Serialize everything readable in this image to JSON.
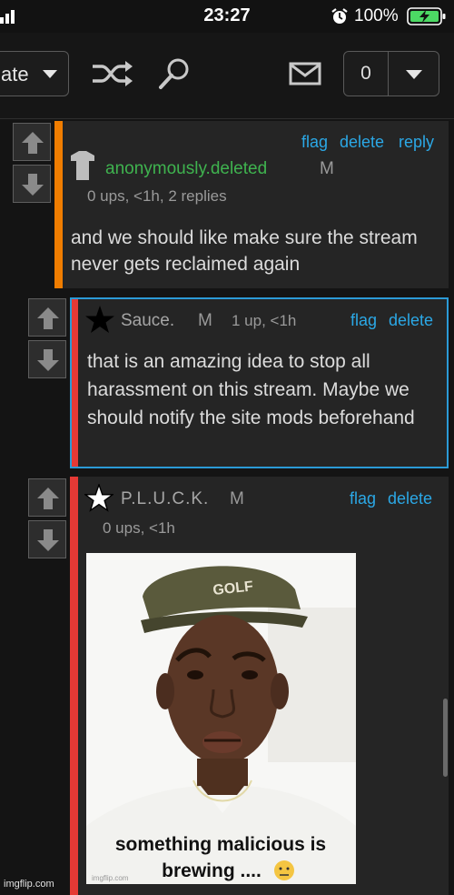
{
  "status_bar": {
    "time": "23:27",
    "battery": "100%",
    "icons": [
      "signal-icon",
      "alarm-icon",
      "battery-charging-icon"
    ]
  },
  "toolbar": {
    "sort_label": "ate",
    "count": "0",
    "icons": [
      "chevron-down-icon",
      "shuffle-icon",
      "search-icon",
      "mail-icon"
    ]
  },
  "colors": {
    "link": "#2ba8e6",
    "username_green": "#3fb34f",
    "orange_bar": "#f07d00",
    "red_bar": "#e53935",
    "blue_border": "#2b9ad6"
  },
  "comments": [
    {
      "avatar": "shirt-icon",
      "author": "anonymously.deleted",
      "mod_label": "M",
      "meta": "0 ups, <1h, 2 replies",
      "actions": {
        "flag": "flag",
        "delete": "delete",
        "reply": "reply"
      },
      "body": "and we should like make sure the stream never gets reclaimed again"
    },
    {
      "avatar": "star-black-icon",
      "author": "Sauce.",
      "mod_label": "M",
      "meta": "1 up, <1h",
      "actions": {
        "flag": "flag",
        "delete": "delete"
      },
      "body": "that is an amazing idea to stop all harassment on this stream. Maybe we should notify the site mods beforehand"
    },
    {
      "avatar": "star-white-icon",
      "author": "P.L.U.C.K.",
      "mod_label": "M",
      "meta": "0 ups, <1h",
      "actions": {
        "flag": "flag",
        "delete": "delete"
      },
      "image": {
        "hat_text": "GOLF",
        "caption_line1": "something malicious is",
        "caption_line2": "brewing ....",
        "watermark": "imgflip.com"
      }
    }
  ],
  "footer": {
    "watermark": "imgflip.com"
  }
}
